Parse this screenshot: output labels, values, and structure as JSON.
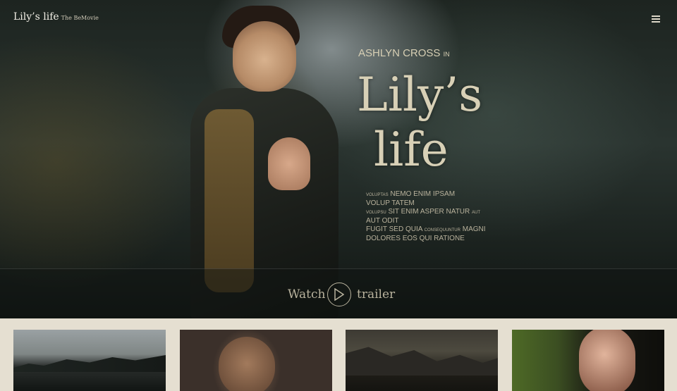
{
  "header": {
    "site_title": "Lily’s life",
    "site_subtitle": "The BeMovie",
    "menu_icon": "hamburger-menu-icon"
  },
  "poster": {
    "actor": "ASHLYN CROSS",
    "actor_suffix": "IN",
    "title_line1": "Lily’s",
    "title_line2": "life",
    "credits": [
      [
        "VOLUPTAS",
        "NEMO ENIM IPSAM",
        "VOLUP TATEM"
      ],
      [
        "VOLUPSU",
        "SIT ENIM",
        "ASPER NATUR",
        "AUT",
        "AUT ODIT"
      ],
      [
        "FUGIT",
        "SED QUIA",
        "CONSEQUUNTUR",
        "MAGNI"
      ],
      [
        "DOLORES",
        "EOS QUI RATIONE"
      ]
    ]
  },
  "watch": {
    "label_left": "Watch",
    "label_right": "trailer",
    "icon": "play-icon"
  },
  "colors": {
    "page_background": "#e7e2d6",
    "poster_text": "#d8d0b6",
    "watch_text": "#b8b29d"
  }
}
